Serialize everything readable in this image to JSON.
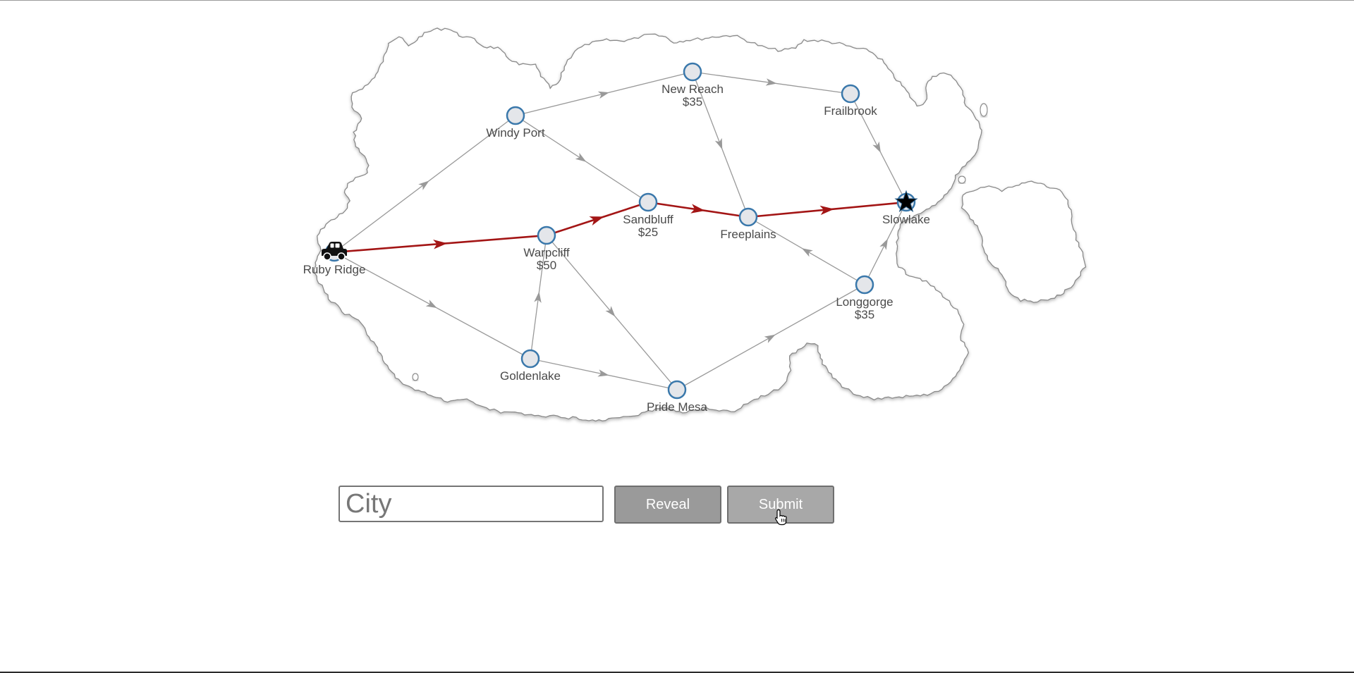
{
  "game": {
    "cities": [
      {
        "id": "ruby-ridge",
        "name": "Ruby Ridge",
        "cost": ""
      },
      {
        "id": "windy-port",
        "name": "Windy Port",
        "cost": ""
      },
      {
        "id": "new-reach",
        "name": "New Reach",
        "cost": "$35"
      },
      {
        "id": "frailbrook",
        "name": "Frailbrook",
        "cost": ""
      },
      {
        "id": "sandbluff",
        "name": "Sandbluff",
        "cost": "$25"
      },
      {
        "id": "warpcliff",
        "name": "Warpcliff",
        "cost": "$50"
      },
      {
        "id": "freeplains",
        "name": "Freeplains",
        "cost": ""
      },
      {
        "id": "slowlake",
        "name": "Slowlake",
        "cost": ""
      },
      {
        "id": "longgorge",
        "name": "Longgorge",
        "cost": "$35"
      },
      {
        "id": "goldenlake",
        "name": "Goldenlake",
        "cost": ""
      },
      {
        "id": "pride-mesa",
        "name": "Pride Mesa",
        "cost": ""
      }
    ],
    "roads": [
      {
        "from": "ruby-ridge",
        "to": "windy-port",
        "highlighted": false
      },
      {
        "from": "ruby-ridge",
        "to": "warpcliff",
        "highlighted": true
      },
      {
        "from": "ruby-ridge",
        "to": "goldenlake",
        "highlighted": false
      },
      {
        "from": "windy-port",
        "to": "new-reach",
        "highlighted": false
      },
      {
        "from": "windy-port",
        "to": "sandbluff",
        "highlighted": false
      },
      {
        "from": "new-reach",
        "to": "frailbrook",
        "highlighted": false
      },
      {
        "from": "new-reach",
        "to": "freeplains",
        "highlighted": false
      },
      {
        "from": "frailbrook",
        "to": "slowlake",
        "highlighted": false
      },
      {
        "from": "warpcliff",
        "to": "sandbluff",
        "highlighted": true
      },
      {
        "from": "warpcliff",
        "to": "pride-mesa",
        "highlighted": false
      },
      {
        "from": "sandbluff",
        "to": "freeplains",
        "highlighted": true
      },
      {
        "from": "freeplains",
        "to": "slowlake",
        "highlighted": true
      },
      {
        "from": "longgorge",
        "to": "freeplains",
        "highlighted": false
      },
      {
        "from": "longgorge",
        "to": "slowlake",
        "highlighted": false
      },
      {
        "from": "goldenlake",
        "to": "warpcliff",
        "highlighted": false
      },
      {
        "from": "goldenlake",
        "to": "pride-mesa",
        "highlighted": false
      },
      {
        "from": "pride-mesa",
        "to": "longgorge",
        "highlighted": false
      }
    ],
    "start_city": "ruby-ridge",
    "goal_city": "slowlake",
    "start_icon": "car-icon",
    "goal_icon": "star-icon",
    "colors": {
      "route": "#a31515",
      "road": "#999999",
      "node_fill": "#e4e6ea",
      "node_stroke": "#3a78ab",
      "land_stroke": "#8a8a8a"
    }
  },
  "controls": {
    "city_placeholder": "City",
    "city_value": "",
    "reveal_label": "Reveal",
    "submit_label": "Submit"
  }
}
